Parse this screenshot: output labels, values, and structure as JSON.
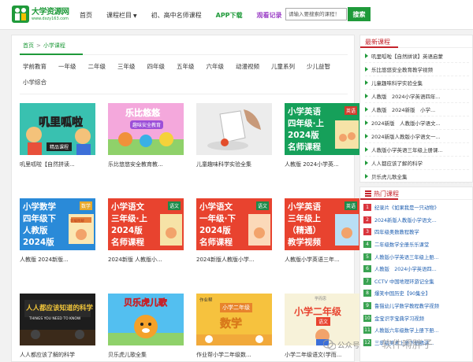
{
  "header": {
    "logo_title": "大学资源网",
    "logo_url": "www.dxzy163.com",
    "nav": [
      {
        "label": "首页",
        "style": "normal"
      },
      {
        "label": "课程栏目",
        "style": "normal",
        "dropdown": true
      },
      {
        "label": "初、高中名师课程",
        "style": "normal"
      },
      {
        "label": "APP下载",
        "style": "green"
      },
      {
        "label": "观看记录",
        "style": "purple"
      }
    ],
    "search_placeholder": "请输入要搜索的课程！",
    "search_button": "搜索"
  },
  "breadcrumb": {
    "home": "首页",
    "separator": ">",
    "current": "小学课程"
  },
  "grades": [
    "学前教育",
    "一年级",
    "二年级",
    "三年级",
    "四年级",
    "五年级",
    "六年级",
    "动漫视频",
    "儿童系列",
    "少儿益智",
    "小学综合"
  ],
  "cards": [
    {
      "title": "叽里呱啦【自然拼读...",
      "thumb_text": "叽里呱啦",
      "thumb_sub": "精品课程"
    },
    {
      "title": "乐比悠悠安全教育教...",
      "thumb_text": "乐比悠悠",
      "thumb_sub": "趣味安全教育"
    },
    {
      "title": "儿童趣味科学实验全集",
      "thumb_text": "",
      "thumb_sub": ""
    },
    {
      "title": "人教版 2024小学英...",
      "thumb_text": "小学英语",
      "thumb_lines": [
        "四年级·上",
        "2024版",
        "名师课程"
      ],
      "thumb_tag": "英语"
    },
    {
      "title": "人教版 2024新版...",
      "thumb_text": "小学数学",
      "thumb_lines": [
        "四年级下",
        "人教版",
        "2024版"
      ],
      "thumb_tag": "数学",
      "thumb_sub": "新编图解"
    },
    {
      "title": "2024新版 人教版小...",
      "thumb_text": "小学语文",
      "thumb_lines": [
        "三年级·上",
        "2024版",
        "名师课程"
      ],
      "thumb_tag": "语文"
    },
    {
      "title": "2024新版人教版小学...",
      "thumb_text": "小学语文",
      "thumb_lines": [
        "一年级·下",
        "2024版",
        "名师课程"
      ],
      "thumb_tag": "语文"
    },
    {
      "title": "人教版小学英语三年...",
      "thumb_text": "小学英语",
      "thumb_lines": [
        "三年级上",
        "（精通）",
        "教学视频"
      ],
      "thumb_tag": "英语"
    },
    {
      "title": "人人都应该了解的科学",
      "thumb_text": "人人都应该知道的科学",
      "thumb_sub": "THINGS YOU NEED TO KNOW"
    },
    {
      "title": "贝乐虎儿歌全集",
      "thumb_text": "贝乐虎儿歌"
    },
    {
      "title": "作业帮小学二年级数...",
      "thumb_text": "数学",
      "thumb_sub": "小学二年级",
      "thumb_tag": "作业帮"
    },
    {
      "title": "小学二年级语文(学而...",
      "thumb_text": "小学二年级",
      "thumb_sub": "语文",
      "thumb_tag": "学而思"
    }
  ],
  "sidebar": {
    "new_title": "最新课程",
    "new_items": [
      "叽里呱啦【自然拼读】英语启蒙",
      "乐比悠悠安全教育教学视频",
      "儿童趣味科学实验全集",
      "人教版　2024小学英语四年...",
      "人教版　2024新版　小学...",
      "2024新版　人教版小学语文...",
      "2024新版人教版小学语文一...",
      "人教版小学英语三年级上册课...",
      "人人都应该了解的科学",
      "贝乐虎儿歌全集"
    ],
    "hot_title": "热门课程",
    "hot_items": [
      "纪录片《如果我是一只动物》",
      "2024新版人教版小学语文...",
      "四年级奥数教程教学",
      "二年级数学全册乐乐课堂",
      "人教版小学英语三年级上册...",
      "人教版　2024小学英语四...",
      "CCTV 中国地理环游记全集",
      "爆笑中国历史【90集全】",
      "鲁猫幼儿学数学教程教学视频",
      "金宝识字宝典学习视频",
      "人教版六年级数学上册下册...",
      "三年级美术上册下册精讲..."
    ]
  },
  "watermark": {
    "text": "公众号 ·",
    "name": "软件嘚胖子"
  },
  "colors": {
    "brand_green": "#1f9a3a",
    "accent_red": "#c4232b",
    "purple": "#9b3fc6",
    "link_blue": "#1f5fb0"
  }
}
